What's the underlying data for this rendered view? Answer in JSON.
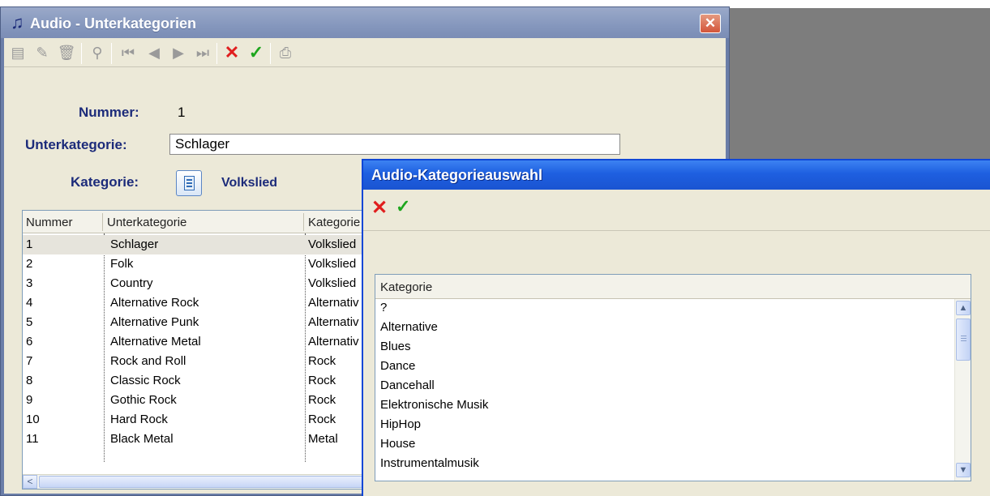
{
  "main_window": {
    "title": "Audio - Unterkategorien",
    "title_icon": "music-note-icon",
    "close_glyph": "✕",
    "toolbar": {
      "icons": [
        "list-icon",
        "edit-icon",
        "delete-icon",
        "search-icon",
        "first-record-icon",
        "previous-record-icon",
        "next-record-icon",
        "last-record-icon",
        "cancel-icon",
        "confirm-icon",
        "print-icon"
      ]
    },
    "form": {
      "nummer_label": "Nummer:",
      "nummer_value": "1",
      "unterkategorie_label": "Unterkategorie:",
      "unterkategorie_value": "Schlager",
      "kategorie_label": "Kategorie:",
      "kategorie_value": "Volkslied"
    },
    "grid": {
      "columns": [
        "Nummer",
        "Unterkategorie",
        "Kategorie"
      ],
      "rows": [
        [
          "1",
          "Schlager",
          "Volkslied"
        ],
        [
          "2",
          "Folk",
          "Volkslied"
        ],
        [
          "3",
          "Country",
          "Volkslied"
        ],
        [
          "4",
          "Alternative Rock",
          "Alternativ"
        ],
        [
          "5",
          "Alternative Punk",
          "Alternativ"
        ],
        [
          "6",
          "Alternative Metal",
          "Alternativ"
        ],
        [
          "7",
          "Rock and Roll",
          "Rock"
        ],
        [
          "8",
          "Classic Rock",
          "Rock"
        ],
        [
          "9",
          "Gothic Rock",
          "Rock"
        ],
        [
          "10",
          "Hard Rock",
          "Rock"
        ],
        [
          "11",
          "Black Metal",
          "Metal"
        ]
      ]
    }
  },
  "dialog": {
    "title": "Audio-Kategorieauswahl",
    "cancel_glyph": "✕",
    "ok_glyph": "✓",
    "list": {
      "header": "Kategorie",
      "items": [
        "?",
        "Alternative",
        "Blues",
        "Dance",
        "Dancehall",
        "Elektronische Musik",
        "HipHop",
        "House",
        "Instrumentalmusik"
      ]
    }
  },
  "colors": {
    "label_blue": "#1c2b7a",
    "dialog_title_blue": "#1e5fe0",
    "cancel_red": "#e01e1e",
    "confirm_green": "#1ea61e"
  }
}
